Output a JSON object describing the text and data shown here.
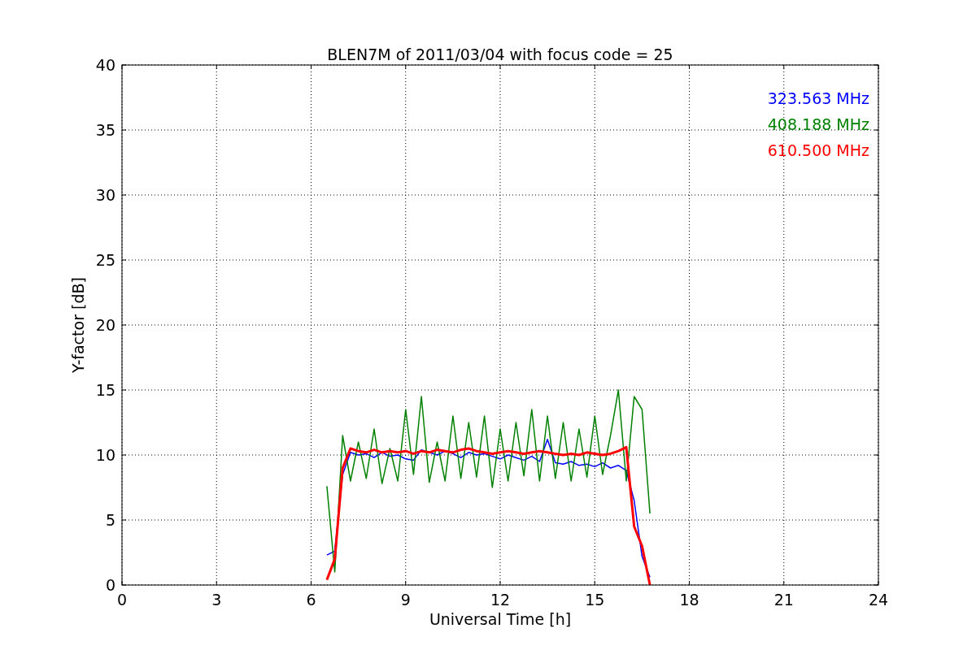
{
  "chart_data": {
    "type": "line",
    "title": "BLEN7M of 2011/03/04 with focus code = 25",
    "xlabel": "Universal Time [h]",
    "ylabel": "Y-factor [dB]",
    "x": [
      6.5,
      6.75,
      7,
      7.25,
      7.5,
      7.75,
      8,
      8.25,
      8.5,
      8.75,
      9,
      9.25,
      9.5,
      9.75,
      10,
      10.25,
      10.5,
      10.75,
      11,
      11.25,
      11.5,
      11.75,
      12,
      12.25,
      12.5,
      12.75,
      13,
      13.25,
      13.5,
      13.75,
      14,
      14.25,
      14.5,
      14.75,
      15,
      15.25,
      15.5,
      15.75,
      16,
      16.25,
      16.5,
      16.75
    ],
    "series": [
      {
        "name": "323.563 MHz",
        "color": "#0000ff",
        "values": [
          2.3,
          2.6,
          8.5,
          10.2,
          10.0,
          10.1,
          9.8,
          10.2,
          9.9,
          10.0,
          9.7,
          9.6,
          10.4,
          10.2,
          10.0,
          10.3,
          10.1,
          9.8,
          10.2,
          10.0,
          10.1,
          9.9,
          9.7,
          10.0,
          9.8,
          9.6,
          9.9,
          9.5,
          11.2,
          9.4,
          9.3,
          9.5,
          9.2,
          9.3,
          9.1,
          9.4,
          9.0,
          9.2,
          8.8,
          6.5,
          2.2,
          0.6
        ]
      },
      {
        "name": "408.188 MHz",
        "color": "#008000",
        "values": [
          7.6,
          1.0,
          11.5,
          8.0,
          11.0,
          8.2,
          12.0,
          7.8,
          10.5,
          8.0,
          13.5,
          8.5,
          14.5,
          7.9,
          11.0,
          8.0,
          13.0,
          8.2,
          12.5,
          8.3,
          13.0,
          7.5,
          12.0,
          8.0,
          12.5,
          8.4,
          13.5,
          8.0,
          13.0,
          8.2,
          12.5,
          8.0,
          12.0,
          8.3,
          13.0,
          8.5,
          11.5,
          15.0,
          8.0,
          14.5,
          13.5,
          5.5
        ]
      },
      {
        "name": "610.500 MHz",
        "color": "#ff0000",
        "values": [
          0.4,
          2.0,
          9.0,
          10.5,
          10.3,
          10.2,
          10.4,
          10.2,
          10.3,
          10.2,
          10.3,
          10.1,
          10.3,
          10.2,
          10.4,
          10.3,
          10.2,
          10.4,
          10.5,
          10.3,
          10.2,
          10.1,
          10.2,
          10.3,
          10.2,
          10.1,
          10.2,
          10.3,
          10.2,
          10.1,
          10.0,
          10.1,
          10.0,
          10.2,
          10.1,
          10.0,
          10.1,
          10.3,
          10.6,
          4.5,
          3.0,
          0.0
        ]
      }
    ],
    "xlim": [
      0,
      24
    ],
    "ylim": [
      0,
      40
    ],
    "xticks": [
      0,
      3,
      6,
      9,
      12,
      15,
      18,
      21,
      24
    ],
    "yticks": [
      0,
      5,
      10,
      15,
      20,
      25,
      30,
      35,
      40
    ],
    "grid": true
  }
}
